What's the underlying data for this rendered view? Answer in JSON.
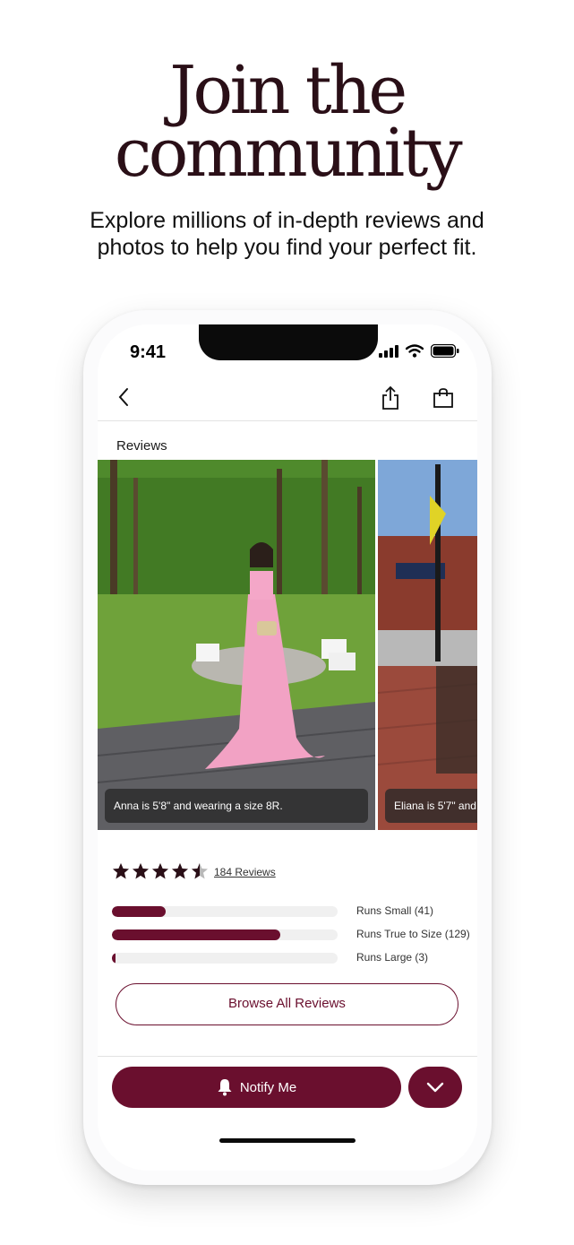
{
  "hero": {
    "title_line1": "Join the",
    "title_line2": "community",
    "subtitle_line1": "Explore millions of in-depth reviews and",
    "subtitle_line2": "photos to help you find your perfect fit."
  },
  "status_bar": {
    "time": "9:41",
    "icons": [
      "signal-icon",
      "wifi-icon",
      "battery-icon"
    ]
  },
  "nav": {
    "icons": [
      "back-chevron-icon",
      "share-icon",
      "shopping-bag-icon"
    ]
  },
  "reviews": {
    "title": "Reviews",
    "photos": [
      {
        "caption": "Anna is 5'8\" and wearing a size 8R."
      },
      {
        "caption": "Eliana is 5'7\" and"
      }
    ],
    "rating": 4.5,
    "rating_max": 5,
    "review_count_label": "184 Reviews",
    "fit": [
      {
        "label": "Runs Small (41)",
        "fraction": 0.237
      },
      {
        "label": "Runs True to Size (129)",
        "fraction": 0.746
      },
      {
        "label": "Runs Large (3)",
        "fraction": 0.017
      }
    ],
    "browse_button": "Browse All Reviews"
  },
  "actions": {
    "notify_label": "Notify Me",
    "notify_icon": "bell-icon",
    "expand_icon": "chevron-down-icon"
  },
  "colors": {
    "brand": "#6a0f2e",
    "headline": "#2a0f17",
    "track": "#f0f0f0"
  }
}
